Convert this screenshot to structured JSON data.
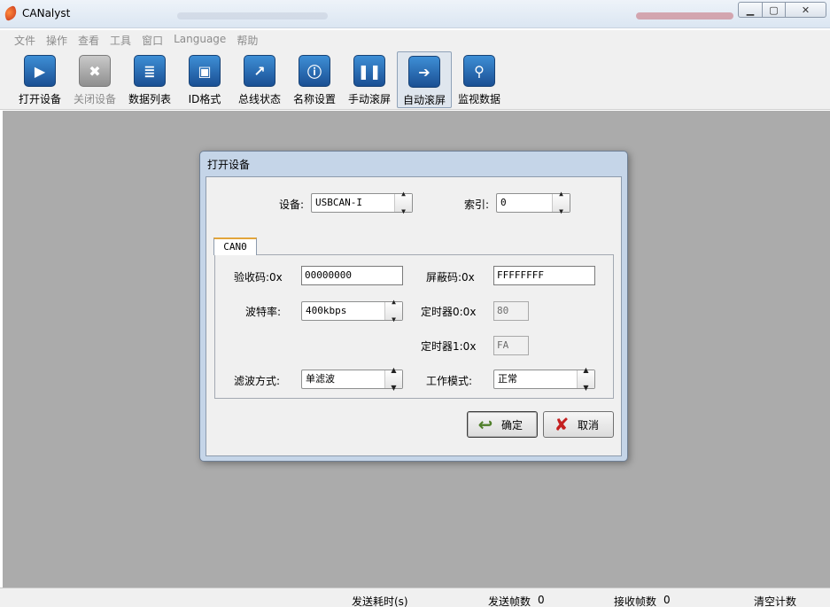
{
  "window": {
    "title": "CANalyst"
  },
  "menu": [
    "文件",
    "操作",
    "查看",
    "工具",
    "窗口",
    "Language",
    "帮助"
  ],
  "toolbar": [
    {
      "label": "打开设备",
      "icon": "play-icon",
      "enabled": true,
      "active": false
    },
    {
      "label": "关闭设备",
      "icon": "close-icon",
      "enabled": false,
      "active": false
    },
    {
      "label": "数据列表",
      "icon": "database-icon",
      "enabled": true,
      "active": false
    },
    {
      "label": "ID格式",
      "icon": "id-format-icon",
      "enabled": true,
      "active": false
    },
    {
      "label": "总线状态",
      "icon": "chart-icon",
      "enabled": true,
      "active": false
    },
    {
      "label": "名称设置",
      "icon": "info-bubble-icon",
      "enabled": true,
      "active": false
    },
    {
      "label": "手动滚屏",
      "icon": "pause-icon",
      "enabled": true,
      "active": false
    },
    {
      "label": "自动滚屏",
      "icon": "arrow-right-icon",
      "enabled": true,
      "active": true
    },
    {
      "label": "监视数据",
      "icon": "search-icon",
      "enabled": true,
      "active": false
    }
  ],
  "dialog": {
    "title": "打开设备",
    "device_label": "设备:",
    "device_value": "USBCAN-I",
    "index_label": "索引:",
    "index_value": "0",
    "tab_label": "CAN0",
    "acc_code_label": "验收码:0x",
    "acc_code_value": "00000000",
    "mask_label": "屏蔽码:0x",
    "mask_value": "FFFFFFFF",
    "baud_label": "波特率:",
    "baud_value": "400kbps",
    "timer0_label": "定时器0:0x",
    "timer0_value": "80",
    "timer1_label": "定时器1:0x",
    "timer1_value": "FA",
    "filter_label": "滤波方式:",
    "filter_value": "单滤波",
    "mode_label": "工作模式:",
    "mode_value": "正常",
    "ok_label": "确定",
    "cancel_label": "取消"
  },
  "status": {
    "send_time_label": "发送耗时(s)",
    "send_frames_label": "发送帧数",
    "send_frames_value": "0",
    "recv_frames_label": "接收帧数",
    "recv_frames_value": "0",
    "clear_label": "清空计数"
  }
}
